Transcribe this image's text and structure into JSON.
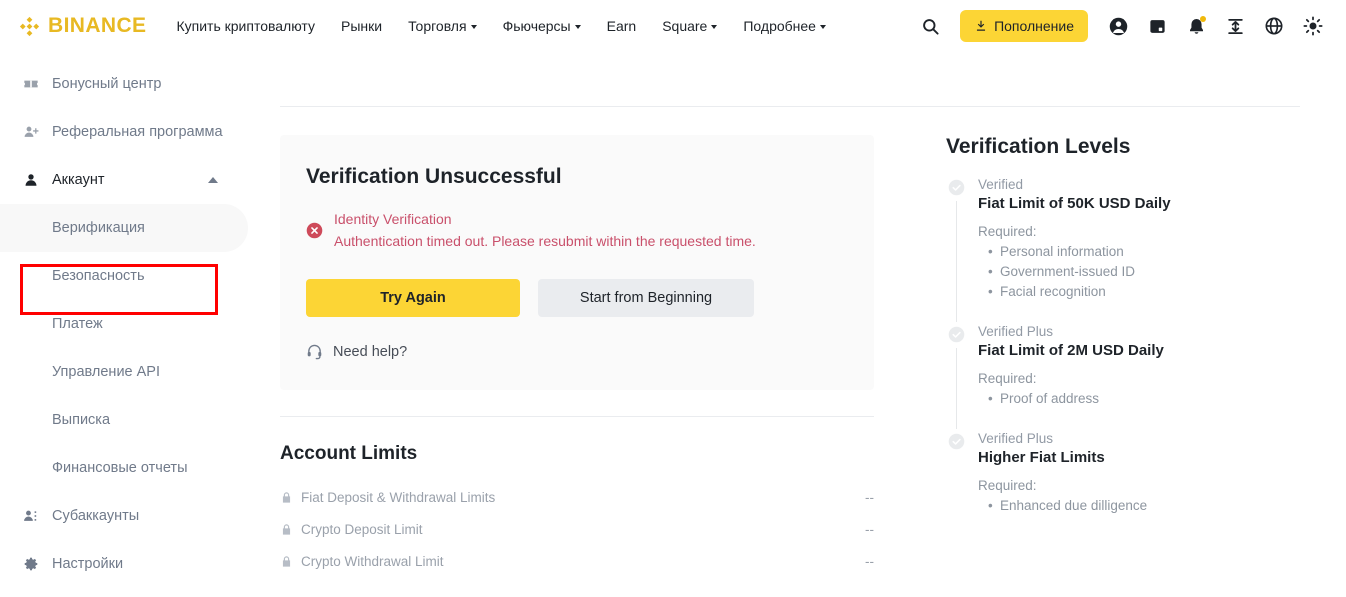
{
  "header": {
    "logo_text": "BINANCE",
    "nav": [
      {
        "label": "Купить криптовалюту",
        "caret": false
      },
      {
        "label": "Рынки",
        "caret": false
      },
      {
        "label": "Торговля",
        "caret": true
      },
      {
        "label": "Фьючерсы",
        "caret": true
      },
      {
        "label": "Earn",
        "caret": false
      },
      {
        "label": "Square",
        "caret": true
      },
      {
        "label": "Подробнее",
        "caret": true
      }
    ],
    "deposit_label": "Пополнение",
    "icons": {
      "search": "search-icon",
      "deposit": "download-icon",
      "profile": "profile-icon",
      "wallet": "wallet-icon",
      "notification": "bell-icon",
      "transfer": "transfer-icon",
      "language": "globe-icon",
      "theme": "theme-icon"
    }
  },
  "sidebar": {
    "items": [
      {
        "label": "Бонусный центр",
        "icon": "ticket-icon",
        "type": "row"
      },
      {
        "label": "Реферальная программа",
        "icon": "user-plus-icon",
        "type": "row"
      },
      {
        "label": "Аккаунт",
        "icon": "user-icon",
        "type": "group",
        "expanded": true
      }
    ],
    "sub_items": [
      {
        "label": "Верификация",
        "active": true
      },
      {
        "label": "Безопасность",
        "active": false
      },
      {
        "label": "Платеж",
        "active": false
      },
      {
        "label": "Управление API",
        "active": false
      },
      {
        "label": "Выписка",
        "active": false
      },
      {
        "label": "Финансовые отчеты",
        "active": false
      }
    ],
    "tail_items": [
      {
        "label": "Субаккаунты",
        "icon": "users-icon"
      },
      {
        "label": "Настройки",
        "icon": "gear-icon"
      }
    ],
    "highlight_color": "#FF0000"
  },
  "verification_card": {
    "title": "Verification Unsuccessful",
    "error_title": "Identity Verification",
    "error_desc": "Authentication timed out. Please resubmit within the requested time.",
    "primary_button": "Try Again",
    "secondary_button": "Start from Beginning",
    "help_label": "Need help?",
    "error_color": "#C9506B",
    "accent_color": "#FCD535"
  },
  "account_limits": {
    "title": "Account Limits",
    "rows": [
      {
        "label": "Fiat Deposit & Withdrawal Limits",
        "value": "--"
      },
      {
        "label": "Crypto Deposit Limit",
        "value": "--"
      },
      {
        "label": "Crypto Withdrawal Limit",
        "value": "--"
      }
    ]
  },
  "verification_levels": {
    "title": "Verification Levels",
    "levels": [
      {
        "tag": "Verified",
        "headline": "Fiat Limit of 50K USD Daily",
        "required_label": "Required:",
        "requirements": [
          "Personal information",
          "Government-issued ID",
          "Facial recognition"
        ]
      },
      {
        "tag": "Verified Plus",
        "headline": "Fiat Limit of 2M USD Daily",
        "required_label": "Required:",
        "requirements": [
          "Proof of address"
        ]
      },
      {
        "tag": "Verified Plus",
        "headline": "Higher Fiat Limits",
        "required_label": "Required:",
        "requirements": [
          "Enhanced due dilligence"
        ]
      }
    ]
  }
}
